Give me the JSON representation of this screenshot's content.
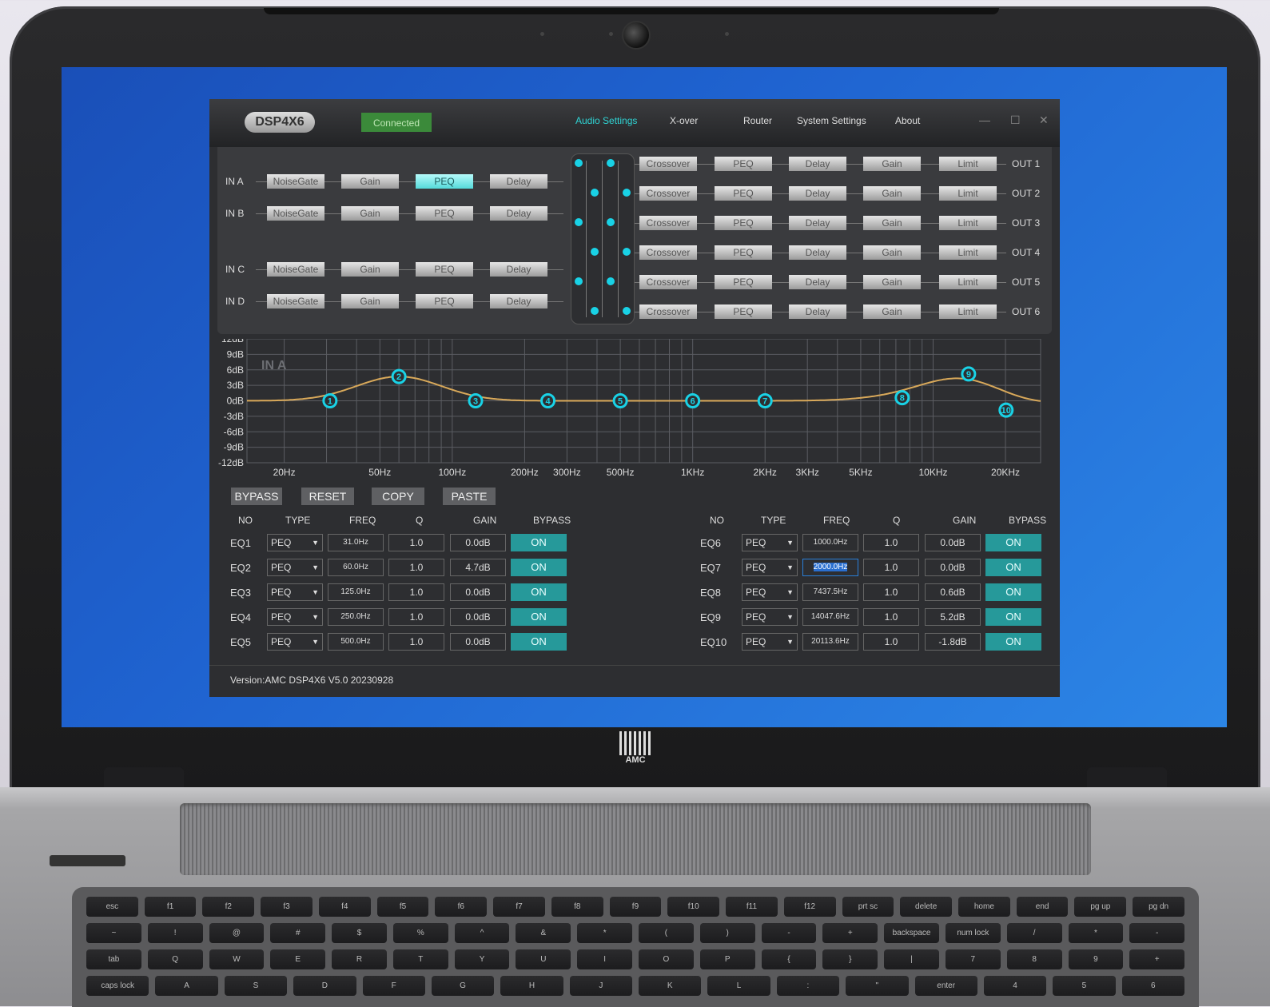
{
  "app": {
    "brand": "DSP4X6",
    "status": "Connected",
    "menu": [
      "Audio Settings",
      "X-over",
      "Router",
      "System Settings",
      "About"
    ],
    "active_menu": "Audio Settings",
    "window_controls": [
      "—",
      "☐",
      "✕"
    ]
  },
  "inputs": [
    {
      "label": "IN A",
      "blocks": [
        "NoiseGate",
        "Gain",
        "PEQ",
        "Delay"
      ],
      "active": "PEQ"
    },
    {
      "label": "IN B",
      "blocks": [
        "NoiseGate",
        "Gain",
        "PEQ",
        "Delay"
      ]
    },
    {
      "label": "IN C",
      "blocks": [
        "NoiseGate",
        "Gain",
        "PEQ",
        "Delay"
      ]
    },
    {
      "label": "IN D",
      "blocks": [
        "NoiseGate",
        "Gain",
        "PEQ",
        "Delay"
      ]
    }
  ],
  "outputs": [
    {
      "label": "OUT 1",
      "blocks": [
        "Crossover",
        "PEQ",
        "Delay",
        "Gain",
        "Limit"
      ]
    },
    {
      "label": "OUT 2",
      "blocks": [
        "Crossover",
        "PEQ",
        "Delay",
        "Gain",
        "Limit"
      ]
    },
    {
      "label": "OUT 3",
      "blocks": [
        "Crossover",
        "PEQ",
        "Delay",
        "Gain",
        "Limit"
      ]
    },
    {
      "label": "OUT 4",
      "blocks": [
        "Crossover",
        "PEQ",
        "Delay",
        "Gain",
        "Limit"
      ]
    },
    {
      "label": "OUT 5",
      "blocks": [
        "Crossover",
        "PEQ",
        "Delay",
        "Gain",
        "Limit"
      ]
    },
    {
      "label": "OUT 6",
      "blocks": [
        "Crossover",
        "PEQ",
        "Delay",
        "Gain",
        "Limit"
      ]
    }
  ],
  "chart_data": {
    "type": "line",
    "title": "IN A",
    "xlabel": "",
    "ylabel": "",
    "x_scale": "log",
    "xlim": [
      14,
      28000
    ],
    "ylim": [
      -12,
      12
    ],
    "y_ticks": [
      "12dB",
      "9dB",
      "6dB",
      "3dB",
      "0dB",
      "-3dB",
      "-6dB",
      "-9dB",
      "-12dB"
    ],
    "x_ticks": [
      {
        "label": "20Hz",
        "value": 20
      },
      {
        "label": "50Hz",
        "value": 50
      },
      {
        "label": "100Hz",
        "value": 100
      },
      {
        "label": "200Hz",
        "value": 200
      },
      {
        "label": "300Hz",
        "value": 300
      },
      {
        "label": "500Hz",
        "value": 500
      },
      {
        "label": "1KHz",
        "value": 1000
      },
      {
        "label": "2KHz",
        "value": 2000
      },
      {
        "label": "3KHz",
        "value": 3000
      },
      {
        "label": "5KHz",
        "value": 5000
      },
      {
        "label": "10KHz",
        "value": 10000
      },
      {
        "label": "20KHz",
        "value": 20000
      }
    ],
    "points": [
      {
        "id": "1",
        "freq": 31.0,
        "gain": 0.0
      },
      {
        "id": "2",
        "freq": 60.0,
        "gain": 4.7
      },
      {
        "id": "3",
        "freq": 125.0,
        "gain": 0.0
      },
      {
        "id": "4",
        "freq": 250.0,
        "gain": 0.0
      },
      {
        "id": "5",
        "freq": 500.0,
        "gain": 0.0
      },
      {
        "id": "6",
        "freq": 1000.0,
        "gain": 0.0
      },
      {
        "id": "7",
        "freq": 2000.0,
        "gain": 0.0
      },
      {
        "id": "8",
        "freq": 7437.5,
        "gain": 0.6
      },
      {
        "id": "9",
        "freq": 14047.6,
        "gain": 5.2
      },
      {
        "id": "10",
        "freq": 20113.6,
        "gain": -1.8
      }
    ],
    "grid": true,
    "colors": {
      "curve": "#d9a95a",
      "points": "#19d2e6",
      "grid": "#5b5d62"
    }
  },
  "eq_buttons": [
    "BYPASS",
    "RESET",
    "COPY",
    "PASTE"
  ],
  "eq_headers": [
    "NO",
    "TYPE",
    "FREQ",
    "Q",
    "GAIN",
    "BYPASS"
  ],
  "eq_rows": [
    {
      "no": "EQ1",
      "type": "PEQ",
      "freq": "31.0Hz",
      "q": "1.0",
      "gain": "0.0dB",
      "bypass": "ON"
    },
    {
      "no": "EQ2",
      "type": "PEQ",
      "freq": "60.0Hz",
      "q": "1.0",
      "gain": "4.7dB",
      "bypass": "ON"
    },
    {
      "no": "EQ3",
      "type": "PEQ",
      "freq": "125.0Hz",
      "q": "1.0",
      "gain": "0.0dB",
      "bypass": "ON"
    },
    {
      "no": "EQ4",
      "type": "PEQ",
      "freq": "250.0Hz",
      "q": "1.0",
      "gain": "0.0dB",
      "bypass": "ON"
    },
    {
      "no": "EQ5",
      "type": "PEQ",
      "freq": "500.0Hz",
      "q": "1.0",
      "gain": "0.0dB",
      "bypass": "ON"
    },
    {
      "no": "EQ6",
      "type": "PEQ",
      "freq": "1000.0Hz",
      "q": "1.0",
      "gain": "0.0dB",
      "bypass": "ON"
    },
    {
      "no": "EQ7",
      "type": "PEQ",
      "freq": "2000.0Hz",
      "q": "1.0",
      "gain": "0.0dB",
      "bypass": "ON"
    },
    {
      "no": "EQ8",
      "type": "PEQ",
      "freq": "7437.5Hz",
      "q": "1.0",
      "gain": "0.6dB",
      "bypass": "ON"
    },
    {
      "no": "EQ9",
      "type": "PEQ",
      "freq": "14047.6Hz",
      "q": "1.0",
      "gain": "5.2dB",
      "bypass": "ON"
    },
    {
      "no": "EQ10",
      "type": "PEQ",
      "freq": "20113.6Hz",
      "q": "1.0",
      "gain": "-1.8dB",
      "bypass": "ON"
    }
  ],
  "footer": {
    "version_label": "Version:",
    "version": "AMC DSP4X6 V5.0 20230928"
  },
  "laptop": {
    "logo": "AMC"
  },
  "keyboard": {
    "rows": [
      [
        "esc",
        "f1",
        "f2",
        "f3",
        "f4",
        "f5",
        "f6",
        "f7",
        "f8",
        "f9",
        "f10",
        "f11",
        "f12",
        "prt sc",
        "delete",
        "home",
        "end",
        "pg up",
        "pg dn"
      ],
      [
        "~",
        "!",
        "@",
        "#",
        "$",
        "%",
        "^",
        "&",
        "*",
        "(",
        ")",
        "-",
        "+",
        "backspace",
        "num lock",
        "/",
        "*",
        "-"
      ],
      [
        "tab",
        "Q",
        "W",
        "E",
        "R",
        "T",
        "Y",
        "U",
        "I",
        "O",
        "P",
        "{",
        "}",
        "|",
        "7",
        "8",
        "9",
        "+"
      ],
      [
        "caps lock",
        "A",
        "S",
        "D",
        "F",
        "G",
        "H",
        "J",
        "K",
        "L",
        ":",
        "\"",
        "enter",
        "4",
        "5",
        "6"
      ]
    ]
  }
}
